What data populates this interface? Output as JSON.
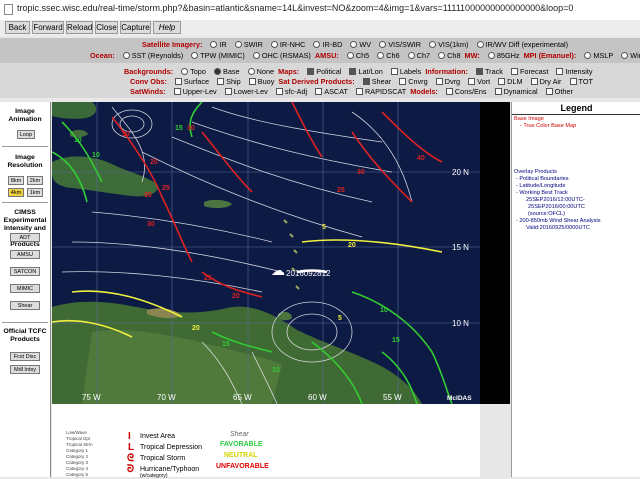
{
  "browser": {
    "url": "tropic.ssec.wisc.edu/real-time/storm.php?&basin=atlantic&sname=14L&invest=NO&zoom=4&img=1&vars=11111000000000000000&loop=0"
  },
  "toolbar": {
    "back": "Back",
    "forward": "Forward",
    "reload": "Reload",
    "close": "Close",
    "capture": "Capture",
    "help": "Help"
  },
  "controls": {
    "sat_label": "Satellite Imagery:",
    "sat_options": [
      "IR",
      "SWIR",
      "IR-NHC",
      "IR-BD",
      "WV",
      "VIS/SWIR",
      "VIS(1km)",
      "IR/WV Diff (experimental)"
    ],
    "ocean_label": "Ocean:",
    "ocean_options": [
      "SST (Reynolds)",
      "TPW (MIMIC)",
      "OHC (RSMAS)"
    ],
    "amsu_label": "AMSU:",
    "amsu_options": [
      "Ch5",
      "Ch6",
      "Ch7",
      "Ch8"
    ],
    "mw_label": "MW:",
    "mw_options": [
      "85GHz"
    ],
    "mpi": "MPI (Emanuel):",
    "mpi_options": [
      "MSLP",
      "Wind"
    ],
    "bg_label": "Backgrounds:",
    "bg_options": [
      "Topo",
      "Base",
      "None"
    ],
    "maps_label": "Maps:",
    "maps_options": [
      "Political",
      "Lat/Lon",
      "Labels"
    ],
    "info_label": "Information:",
    "info_options": [
      "Track",
      "Forecast",
      "Intensity"
    ],
    "conv_label": "Conv Obs:",
    "conv_options": [
      "Surface",
      "Ship",
      "Buoy"
    ],
    "satder_label": "Sat Derived Products:",
    "satder_options": [
      "Shear",
      "Cnvrg",
      "Dvrg",
      "Vort",
      "DLM",
      "Dry Air",
      "TOT"
    ],
    "satwinds_label": "SatWinds:",
    "satwinds_options": [
      "Upper-Lev",
      "Lower-Lev",
      "sfc-Adj",
      "ASCAT",
      "RAPIDSCAT"
    ],
    "models_label": "Models:",
    "models_options": [
      "Cons/Ens",
      "Dynamical",
      "Other"
    ]
  },
  "left_panel": {
    "anim_title": "Image Animation",
    "loop": "Loop",
    "res_title": "Image Resolution",
    "res": [
      "8km",
      "2km",
      "4km",
      "1km"
    ],
    "cimss_title": "CIMSS Experimental Intensity and Structure Products",
    "products": [
      "ADT",
      "AMSU",
      "SATCON",
      "MIMIC",
      "Shear"
    ],
    "official_title": "Official TCFC Products",
    "official": [
      "Fcst Disc",
      "Mdl Intsy"
    ]
  },
  "legend": {
    "title": "Legend",
    "base_title": "Base Image",
    "base_item": "- True Color Base Map",
    "overlay_title": "Overlay Products",
    "overlays": [
      "- Political Boundaries",
      "- Latitude/Longitude",
      "- Working Best Track",
      "25SEP2016/12:00UTC-",
      "25SEP2016/00:00UTC",
      "(source:OFCL)",
      "- 200-850mb Wind Shear Analysis",
      "Valid:20160925/0000UTC"
    ]
  },
  "map": {
    "lat_labels": [
      "20 N",
      "15 N",
      "10 N"
    ],
    "lon_labels": [
      "75 W",
      "70 W",
      "65 W",
      "60 W",
      "55 W"
    ],
    "storm_label": "2016092812",
    "logo": "McIDAS",
    "contours": [
      "10",
      "10",
      "15",
      "20",
      "25",
      "30",
      "30",
      "30",
      "30",
      "40",
      "20",
      "5",
      "5",
      "10",
      "15",
      "20",
      "10",
      "15",
      "20",
      "25",
      "30",
      "25"
    ]
  },
  "bottom_legend": {
    "storm_types": [
      "Invest Area",
      "Tropical Depression",
      "Tropical Storm",
      "Hurricane/Typhoon"
    ],
    "hurricane_note": "(w/category)",
    "shear_title": "Shear",
    "shear": [
      "FAVORABLE",
      "NEUTRAL",
      "UNFAVORABLE"
    ],
    "track_key": [
      "Low/Wave",
      "Tropical Dpr",
      "Tropical Strm",
      "Category 1",
      "Category 2",
      "Category 3",
      "Category 4",
      "Category 5"
    ]
  },
  "colors": {
    "tropical_depression": "#cc0000",
    "favorable": "#2ecc40",
    "neutral": "#e6e600",
    "unfavorable": "#dd0000",
    "shear_high": "#dd2222",
    "shear_mid": "#f0f040",
    "shear_low": "#33cc33"
  }
}
